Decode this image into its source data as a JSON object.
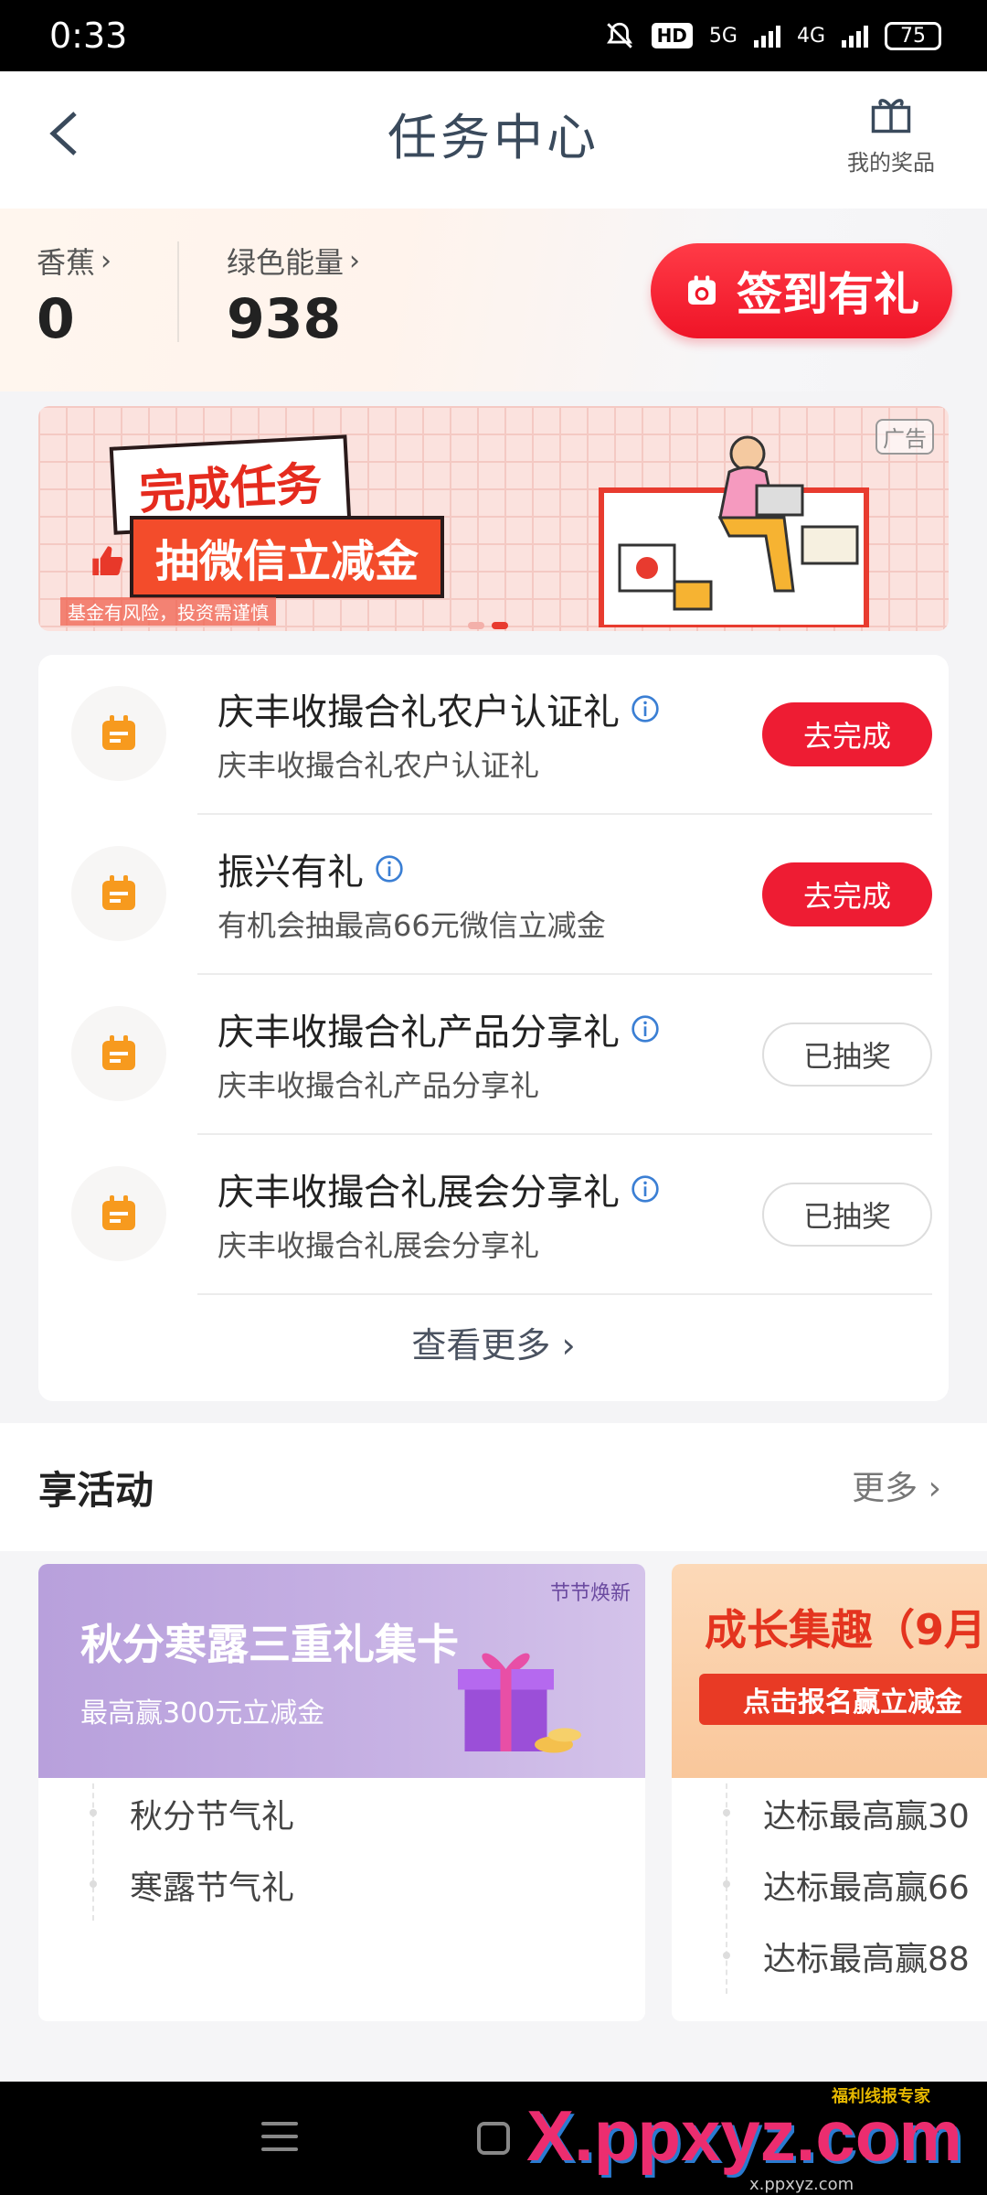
{
  "status_bar": {
    "time": "0:33",
    "hd": "HD",
    "net1": "5G",
    "net2": "4G",
    "battery": "75"
  },
  "header": {
    "title": "任务中心",
    "my_prizes": "我的奖品"
  },
  "balance": {
    "banana_label": "香蕉",
    "banana_value": "0",
    "energy_label": "绿色能量",
    "energy_value": "938",
    "checkin_label": "签到有礼"
  },
  "banner": {
    "line1": "完成任务",
    "line2": "抽微信立减金",
    "ad_tag": "广告",
    "disclaimer": "基金有风险，投资需谨慎"
  },
  "tasks": [
    {
      "title": "庆丰收撮合礼农户认证礼",
      "subtitle": "庆丰收撮合礼农户认证礼",
      "button": "去完成",
      "state": "go"
    },
    {
      "title": "振兴有礼",
      "subtitle": "有机会抽最高66元微信立减金",
      "button": "去完成",
      "state": "go"
    },
    {
      "title": "庆丰收撮合礼产品分享礼",
      "subtitle": "庆丰收撮合礼产品分享礼",
      "button": "已抽奖",
      "state": "done"
    },
    {
      "title": "庆丰收撮合礼展会分享礼",
      "subtitle": "庆丰收撮合礼展会分享礼",
      "button": "已抽奖",
      "state": "done"
    }
  ],
  "see_more": "查看更多",
  "activities": {
    "title": "享活动",
    "more": "更多",
    "cards": [
      {
        "banner_title": "秋分寒露三重礼集卡",
        "banner_sub": "最高赢300元立减金",
        "banner_tag": "节节焕新",
        "items": [
          "秋分节气礼",
          "寒露节气礼"
        ]
      },
      {
        "banner_title": "成长集趣（9月",
        "banner_sub": "点击报名赢立减金",
        "items": [
          "达标最高赢30",
          "达标最高赢66",
          "达标最高赢88"
        ]
      }
    ]
  },
  "watermark": {
    "main": "X.ppxyz.com",
    "small": "福利线报专家",
    "url": "x.ppxyz.com"
  },
  "colors": {
    "accent_red": "#ee1c33",
    "title_slate": "#3a4a5c",
    "task_icon_orange": "#f79a1e"
  }
}
